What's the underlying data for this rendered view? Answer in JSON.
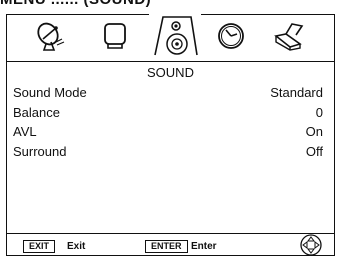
{
  "heading": "MENU ...... (SOUND)",
  "icons": [
    "satellite-dish-icon",
    "monitor-icon",
    "speaker-icon",
    "clock-icon",
    "lock-icon"
  ],
  "menu": {
    "title": "SOUND",
    "items": [
      {
        "label": "Sound Mode",
        "value": "Standard"
      },
      {
        "label": "Balance",
        "value": "0"
      },
      {
        "label": "AVL",
        "value": "On"
      },
      {
        "label": "Surround",
        "value": "Off"
      }
    ]
  },
  "footer": {
    "exit_key": "EXIT",
    "exit_label": "Exit",
    "enter_key": "ENTER",
    "enter_label": "Enter"
  }
}
